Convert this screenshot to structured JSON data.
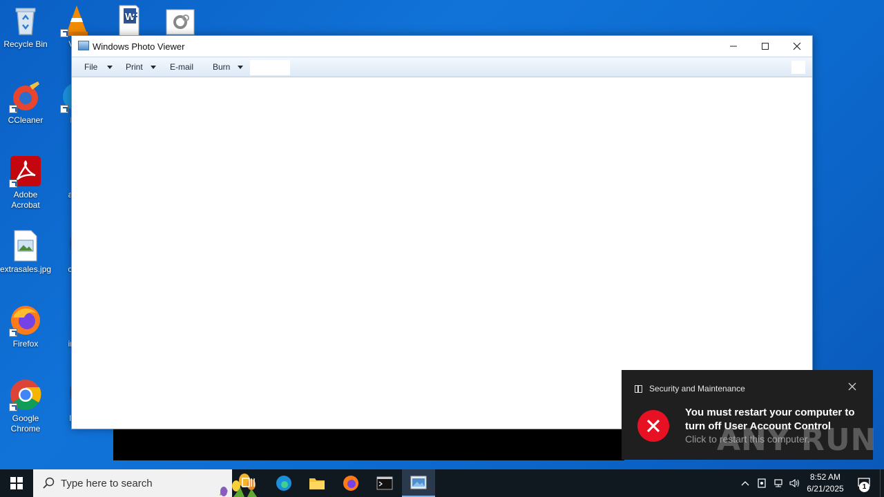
{
  "desktop": {
    "icons": [
      {
        "label": "Recycle Bin"
      },
      {
        "label": "VLC"
      },
      {
        "label": "CCleaner"
      },
      {
        "label": "Mic"
      },
      {
        "label": "Adobe Acrobat"
      },
      {
        "label": "avail"
      },
      {
        "label": "extrasales.jpg"
      },
      {
        "label": "caus"
      },
      {
        "label": "Firefox"
      },
      {
        "label": "inclu"
      },
      {
        "label": "Google Chrome"
      },
      {
        "label": "lass"
      }
    ]
  },
  "photo_viewer": {
    "title": "Windows Photo Viewer",
    "menu": {
      "file": "File",
      "print": "Print",
      "email": "E-mail",
      "burn": "Burn"
    }
  },
  "toast": {
    "app_name": "Security and Maintenance",
    "headline": "You must restart your computer to turn off User Account Control",
    "subtext": "Click to restart this computer.",
    "error_color": "#e81123"
  },
  "watermark": "ANY RUN",
  "taskbar": {
    "search_placeholder": "Type here to search",
    "time": "8:52 AM",
    "date": "6/21/2025",
    "notification_count": "1"
  }
}
